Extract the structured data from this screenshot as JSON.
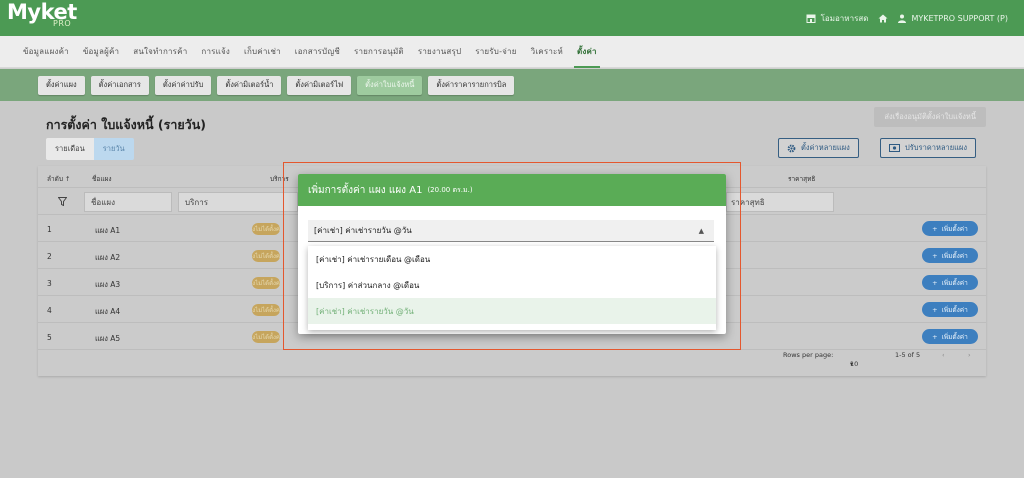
{
  "app": {
    "logo": "Myket",
    "logo_sub": "PRO",
    "store_label": "โอมอาหารสด",
    "user_label": "MYKETPRO SUPPORT (P)"
  },
  "main_nav": [
    {
      "label": "ข้อมูลแผงค้า"
    },
    {
      "label": "ข้อมูลผู้ค้า"
    },
    {
      "label": "สนใจทำการค้า"
    },
    {
      "label": "การแจ้ง"
    },
    {
      "label": "เก็บค่าเช่า"
    },
    {
      "label": "เอกสารบัญชี"
    },
    {
      "label": "รายการอนุมัติ"
    },
    {
      "label": "รายงานสรุป"
    },
    {
      "label": "รายรับ-จ่าย"
    },
    {
      "label": "วิเคราะห์"
    },
    {
      "label": "ตั้งค่า",
      "active": true
    }
  ],
  "sub_nav": [
    {
      "label": "ตั้งค่าแผง"
    },
    {
      "label": "ตั้งค่าเอกสาร"
    },
    {
      "label": "ตั้งค่าค่าปรับ"
    },
    {
      "label": "ตั้งค่ามิเตอร์น้ำ"
    },
    {
      "label": "ตั้งค่ามิเตอร์ไฟ"
    },
    {
      "label": "ตั้งค่าใบแจ้งหนี้",
      "active": true
    },
    {
      "label": "ตั้งค่าราคารายการบิล"
    }
  ],
  "page": {
    "title": "การตั้งค่า ใบแจ้งหนี้ (รายวัน)",
    "tabs": [
      "รายเดือน",
      "รายวัน"
    ],
    "approve_button": "ส่งเรื่องอนุมัติตั้งค่าใบแจ้งหนี้",
    "multi_setting_button": "ตั้งค่าหลายแผง",
    "multi_price_button": "ปรับราคาหลายแผง"
  },
  "table": {
    "headers": {
      "order": "ลำดับ ↑",
      "name": "ชื่อแผง",
      "service": "บริการ",
      "price": "ราคาสุทธิ"
    },
    "filters": {
      "name": "ชื่อแผง",
      "service": "บริการ",
      "price": "ราคาสุทธิ"
    },
    "rows": [
      {
        "order": "1",
        "name": "แผง A1",
        "tag": "ยังไม่ได้ตั้งค่า",
        "action": "เพิ่มตั้งค่า"
      },
      {
        "order": "2",
        "name": "แผง A2",
        "tag": "ยังไม่ได้ตั้งค่า",
        "action": "เพิ่มตั้งค่า"
      },
      {
        "order": "3",
        "name": "แผง A3",
        "tag": "ยังไม่ได้ตั้งค่า",
        "action": "เพิ่มตั้งค่า"
      },
      {
        "order": "4",
        "name": "แผง A4",
        "tag": "ยังไม่ได้ตั้งค่า",
        "action": "เพิ่มตั้งค่า"
      },
      {
        "order": "5",
        "name": "แผง A5",
        "tag": "ยังไม่ได้ตั้งค่า",
        "action": "เพิ่มตั้งค่า"
      }
    ],
    "pager": {
      "rows_label": "Rows per page:",
      "rows_value": "10",
      "range": "1-5 of 5"
    }
  },
  "modal": {
    "title": "เพิ่มการตั้งค่า แผง แผง A1",
    "title_small": "(20.00 ตร.ม.)",
    "selected_value": "[ค่าเช่า] ค่าเช่ารายวัน @วัน",
    "options": [
      {
        "label": "[ค่าเช่า] ค่าเช่ารายเดือน @เดือน"
      },
      {
        "label": "[บริการ] ค่าส่วนกลาง @เดือน"
      },
      {
        "label": "[ค่าเช่า] ค่าเช่ารายวัน @วัน",
        "selected": true
      }
    ]
  },
  "colors": {
    "brand_green": "#4c9a54",
    "accent_blue": "#3d7fbf",
    "highlight": "#e4572e"
  }
}
